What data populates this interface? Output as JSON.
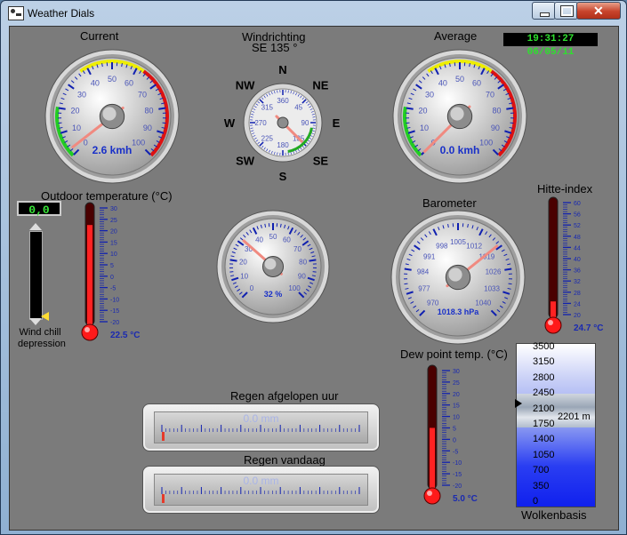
{
  "window": {
    "title": "Weather Dials"
  },
  "clock": "19:31:27 06/05/11",
  "wind_current": {
    "title": "Current",
    "ticks": [
      "0",
      "10",
      "20",
      "30",
      "40",
      "50",
      "60",
      "70",
      "80",
      "90",
      "100"
    ],
    "unit": "2.6 kmh",
    "value": 2.6
  },
  "wind_direction": {
    "title": "Windrichting",
    "subtitle": "SE  135 °",
    "value_deg": 135,
    "compass": [
      "N",
      "NE",
      "E",
      "SE",
      "S",
      "SW",
      "W",
      "NW"
    ],
    "ticks": [
      "0",
      "45",
      "90",
      "135",
      "180",
      "225",
      "270",
      "315",
      "360"
    ]
  },
  "wind_average": {
    "title": "Average",
    "ticks": [
      "0",
      "10",
      "20",
      "30",
      "40",
      "50",
      "60",
      "70",
      "80",
      "90",
      "100"
    ],
    "unit": "0.0 kmh",
    "value": 0.0
  },
  "outdoor_temp": {
    "title": "Outdoor temperature (°C)",
    "value": 22.5,
    "value_label": "22.5 °C",
    "ticks": [
      "30",
      "25",
      "20",
      "15",
      "10",
      "5",
      "0",
      "-5",
      "-10",
      "-15",
      "-20"
    ]
  },
  "wind_chill": {
    "value": "0,0",
    "label": "Wind chill depression"
  },
  "humidity": {
    "ticks": [
      "0",
      "10",
      "20",
      "30",
      "40",
      "50",
      "60",
      "70",
      "80",
      "90",
      "100"
    ],
    "unit": "32 %",
    "value": 32
  },
  "barometer": {
    "title": "Barometer",
    "ticks": [
      "970",
      "977",
      "984",
      "991",
      "998",
      "1005",
      "1012",
      "1019",
      "1026",
      "1033",
      "1040"
    ],
    "unit": "1018.3 hPa",
    "value": 1018.3
  },
  "heat_index": {
    "title": "Hitte-index",
    "value": 24.7,
    "value_label": "24.7 °C",
    "ticks": [
      "60",
      "56",
      "52",
      "48",
      "44",
      "40",
      "36",
      "32",
      "28",
      "24",
      "20"
    ]
  },
  "dew_point": {
    "title": "Dew point temp. (°C)",
    "value": 5.0,
    "value_label": "5.0 °C",
    "ticks": [
      "30",
      "25",
      "20",
      "15",
      "10",
      "5",
      "0",
      "-5",
      "-10",
      "-15",
      "-20"
    ]
  },
  "rain_hour": {
    "title": "Regen afgelopen uur",
    "value": "0.0 mm"
  },
  "rain_today": {
    "title": "Regen vandaag",
    "value": "0.0 mm"
  },
  "cloud_base": {
    "title": "Wolkenbasis",
    "value": "2201 m",
    "ticks": [
      "3500",
      "3150",
      "2800",
      "2450",
      "2100",
      "1750",
      "1400",
      "1050",
      "700",
      "350",
      "0"
    ]
  }
}
